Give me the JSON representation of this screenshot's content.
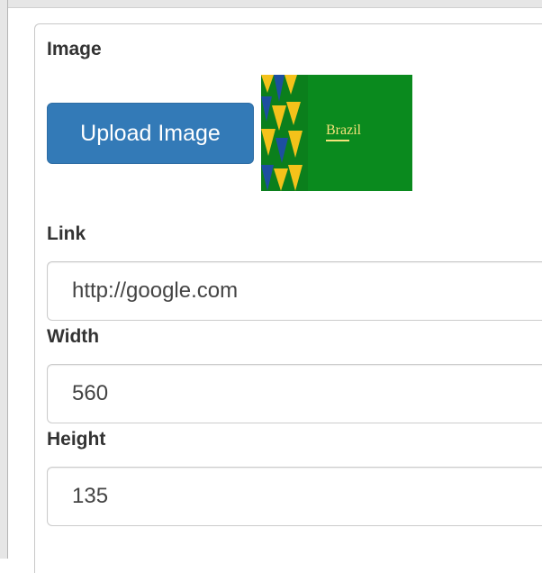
{
  "form": {
    "image_label": "Image",
    "upload_button": "Upload Image",
    "thumbnail_text": "Brazil",
    "link_label": "Link",
    "link_value": "http://google.com",
    "width_label": "Width",
    "width_value": "560",
    "height_label": "Height",
    "height_value": "135"
  },
  "colors": {
    "primary": "#337ab7",
    "thumbnail_green": "#0a8a1e",
    "thumbnail_yellow": "#f4c21a",
    "thumbnail_blue": "#1d4fa0"
  }
}
